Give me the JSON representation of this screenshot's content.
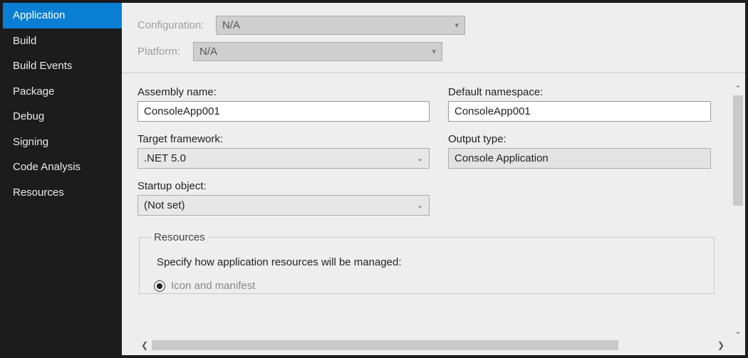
{
  "sidebar": {
    "items": [
      {
        "label": "Application",
        "selected": true
      },
      {
        "label": "Build",
        "selected": false
      },
      {
        "label": "Build Events",
        "selected": false
      },
      {
        "label": "Package",
        "selected": false
      },
      {
        "label": "Debug",
        "selected": false
      },
      {
        "label": "Signing",
        "selected": false
      },
      {
        "label": "Code Analysis",
        "selected": false
      },
      {
        "label": "Resources",
        "selected": false
      }
    ]
  },
  "config": {
    "configuration_label": "Configuration:",
    "configuration_value": "N/A",
    "platform_label": "Platform:",
    "platform_value": "N/A"
  },
  "form": {
    "assembly_name_label": "Assembly name:",
    "assembly_name_value": "ConsoleApp001",
    "default_namespace_label": "Default namespace:",
    "default_namespace_value": "ConsoleApp001",
    "target_framework_label": "Target framework:",
    "target_framework_value": ".NET 5.0",
    "output_type_label": "Output type:",
    "output_type_value": "Console Application",
    "startup_object_label": "Startup object:",
    "startup_object_value": "(Not set)"
  },
  "resources": {
    "legend": "Resources",
    "description": "Specify how application resources will be managed:",
    "radio1_label": "Icon and manifest",
    "radio1_checked": true
  }
}
